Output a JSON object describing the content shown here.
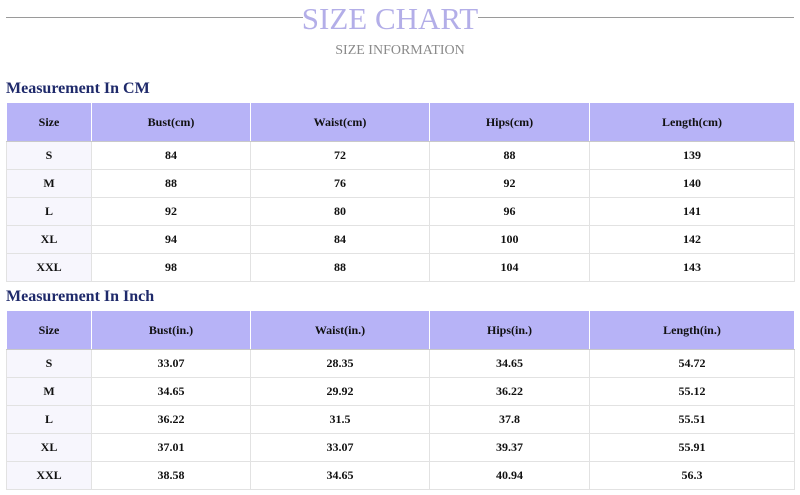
{
  "header": {
    "title": "SIZE CHART",
    "subtitle": "SIZE INFORMATION"
  },
  "colors": {
    "title": "#b3aee8",
    "header_fill": "#b7b3f7",
    "section_title": "#1f2a6b"
  },
  "cm": {
    "section_title": "Measurement In CM",
    "headers": [
      "Size",
      "Bust(cm)",
      "Waist(cm)",
      "Hips(cm)",
      "Length(cm)"
    ],
    "rows": [
      [
        "S",
        "84",
        "72",
        "88",
        "139"
      ],
      [
        "M",
        "88",
        "76",
        "92",
        "140"
      ],
      [
        "L",
        "92",
        "80",
        "96",
        "141"
      ],
      [
        "XL",
        "94",
        "84",
        "100",
        "142"
      ],
      [
        "XXL",
        "98",
        "88",
        "104",
        "143"
      ]
    ]
  },
  "inch": {
    "section_title": "Measurement In Inch",
    "headers": [
      "Size",
      "Bust(in.)",
      "Waist(in.)",
      "Hips(in.)",
      "Length(in.)"
    ],
    "rows": [
      [
        "S",
        "33.07",
        "28.35",
        "34.65",
        "54.72"
      ],
      [
        "M",
        "34.65",
        "29.92",
        "36.22",
        "55.12"
      ],
      [
        "L",
        "36.22",
        "31.5",
        "37.8",
        "55.51"
      ],
      [
        "XL",
        "37.01",
        "33.07",
        "39.37",
        "55.91"
      ],
      [
        "XXL",
        "38.58",
        "34.65",
        "40.94",
        "56.3"
      ]
    ]
  }
}
